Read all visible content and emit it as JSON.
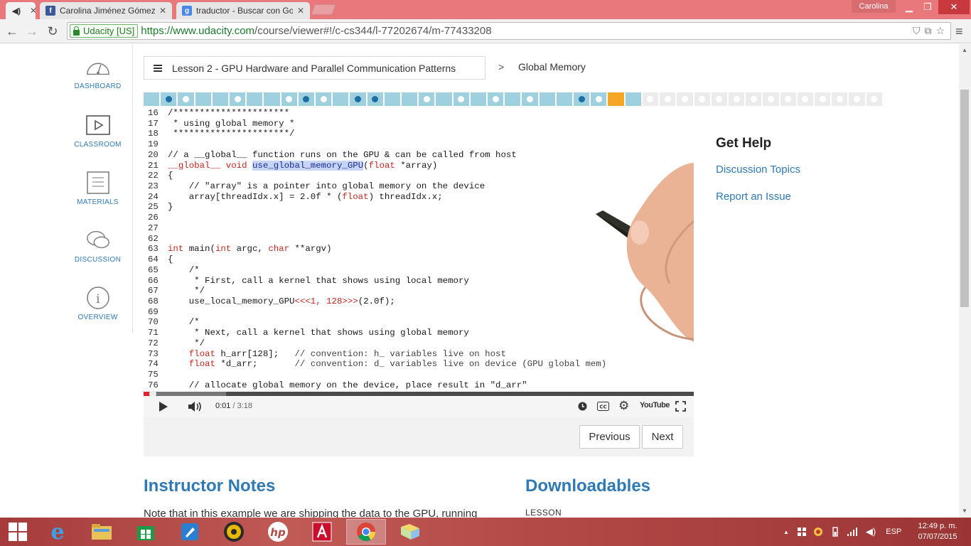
{
  "browser": {
    "tabs": [
      {
        "title": "Carolina Jiménez Gómez",
        "favicon": "facebook-icon",
        "color": "#3b5998"
      },
      {
        "title": "traductor - Buscar con Go",
        "favicon": "google-icon",
        "color": "#4a86e8"
      }
    ],
    "active_tab_favicon": "speaker-icon",
    "user_name": "Carolina",
    "secure_label": "Udacity [US]",
    "url_scheme": "https://",
    "url_host": "www.udacity.com",
    "url_path": "/course/viewer#!/c-cs344/l-77202674/m-77433208"
  },
  "sidebar": {
    "items": [
      {
        "label": "DASHBOARD",
        "icon": "gauge-icon"
      },
      {
        "label": "CLASSROOM",
        "icon": "play-icon"
      },
      {
        "label": "MATERIALS",
        "icon": "document-icon"
      },
      {
        "label": "DISCUSSION",
        "icon": "chat-icon"
      },
      {
        "label": "OVERVIEW",
        "icon": "info-icon"
      }
    ]
  },
  "breadcrumb": {
    "lesson": "Lesson 2 - GPU Hardware and Parallel Communication Patterns",
    "separator": ">",
    "current": "Global Memory"
  },
  "lesson_progress": {
    "total": 43,
    "current_index": 27,
    "completed_through": 29,
    "markers": {
      "1": "b",
      "2": "w",
      "5": "w",
      "8": "w",
      "9": "b",
      "10": "w",
      "12": "b",
      "13": "b",
      "16": "w",
      "18": "w",
      "20": "w",
      "22": "w",
      "25": "b",
      "26": "w",
      "36": "w",
      "37": "w",
      "42": "w"
    }
  },
  "video": {
    "code_lines": [
      {
        "n": "16",
        "t": "/**********************"
      },
      {
        "n": "17",
        "t": " * using global memory *"
      },
      {
        "n": "18",
        "t": " **********************/"
      },
      {
        "n": "19",
        "t": ""
      },
      {
        "n": "20",
        "t": "// a __global__ function runs on the GPU & can be called from host"
      },
      {
        "n": "21",
        "t": "__global__ void use_global_memory_GPU(float *array)"
      },
      {
        "n": "22",
        "t": "{"
      },
      {
        "n": "23",
        "t": "    // \"array\" is a pointer into global memory on the device"
      },
      {
        "n": "24",
        "t": "    array[threadIdx.x] = 2.0f * (float) threadIdx.x;"
      },
      {
        "n": "25",
        "t": "}"
      },
      {
        "n": "26",
        "t": ""
      },
      {
        "n": "27",
        "t": ""
      },
      {
        "n": "62",
        "t": ""
      },
      {
        "n": "63",
        "t": "int main(int argc, char **argv)"
      },
      {
        "n": "64",
        "t": "{"
      },
      {
        "n": "65",
        "t": "    /*"
      },
      {
        "n": "66",
        "t": "     * First, call a kernel that shows using local memory"
      },
      {
        "n": "67",
        "t": "     */"
      },
      {
        "n": "68",
        "t": "    use_local_memory_GPU<<<1, 128>>>(2.0f);"
      },
      {
        "n": "69",
        "t": ""
      },
      {
        "n": "70",
        "t": "    /*"
      },
      {
        "n": "71",
        "t": "     * Next, call a kernel that shows using global memory"
      },
      {
        "n": "72",
        "t": "     */"
      },
      {
        "n": "73",
        "t": "    float h_arr[128];   // convention: h_ variables live on host"
      },
      {
        "n": "74",
        "t": "    float *d_arr;       // convention: d_ variables live on device (GPU global mem)"
      },
      {
        "n": "75",
        "t": ""
      },
      {
        "n": "76",
        "t": "    // allocate global memory on the device, place result in \"d_arr\""
      }
    ],
    "current_time": "0:01",
    "duration": "/ 3:18",
    "played_fraction": 0.005,
    "buffered_fraction": 0.15,
    "youtube_label": "YouTube",
    "previous_label": "Previous",
    "next_label": "Next"
  },
  "help": {
    "title": "Get Help",
    "links": [
      "Discussion Topics",
      "Report an Issue"
    ]
  },
  "lower": {
    "notes_title": "Instructor Notes",
    "notes_text": "Note that in this example we are shipping the data to the GPU, running",
    "downloads_title": "Downloadables",
    "lesson_label": "LESSON"
  },
  "taskbar": {
    "apps": [
      "ie-icon",
      "explorer-icon",
      "store-icon",
      "rocket-icon",
      "media-icon",
      "hp-icon",
      "adobe-icon",
      "chrome-icon",
      "folder-icon"
    ],
    "language": "ESP",
    "time": "12:49 p. m.",
    "date": "07/07/2015"
  }
}
